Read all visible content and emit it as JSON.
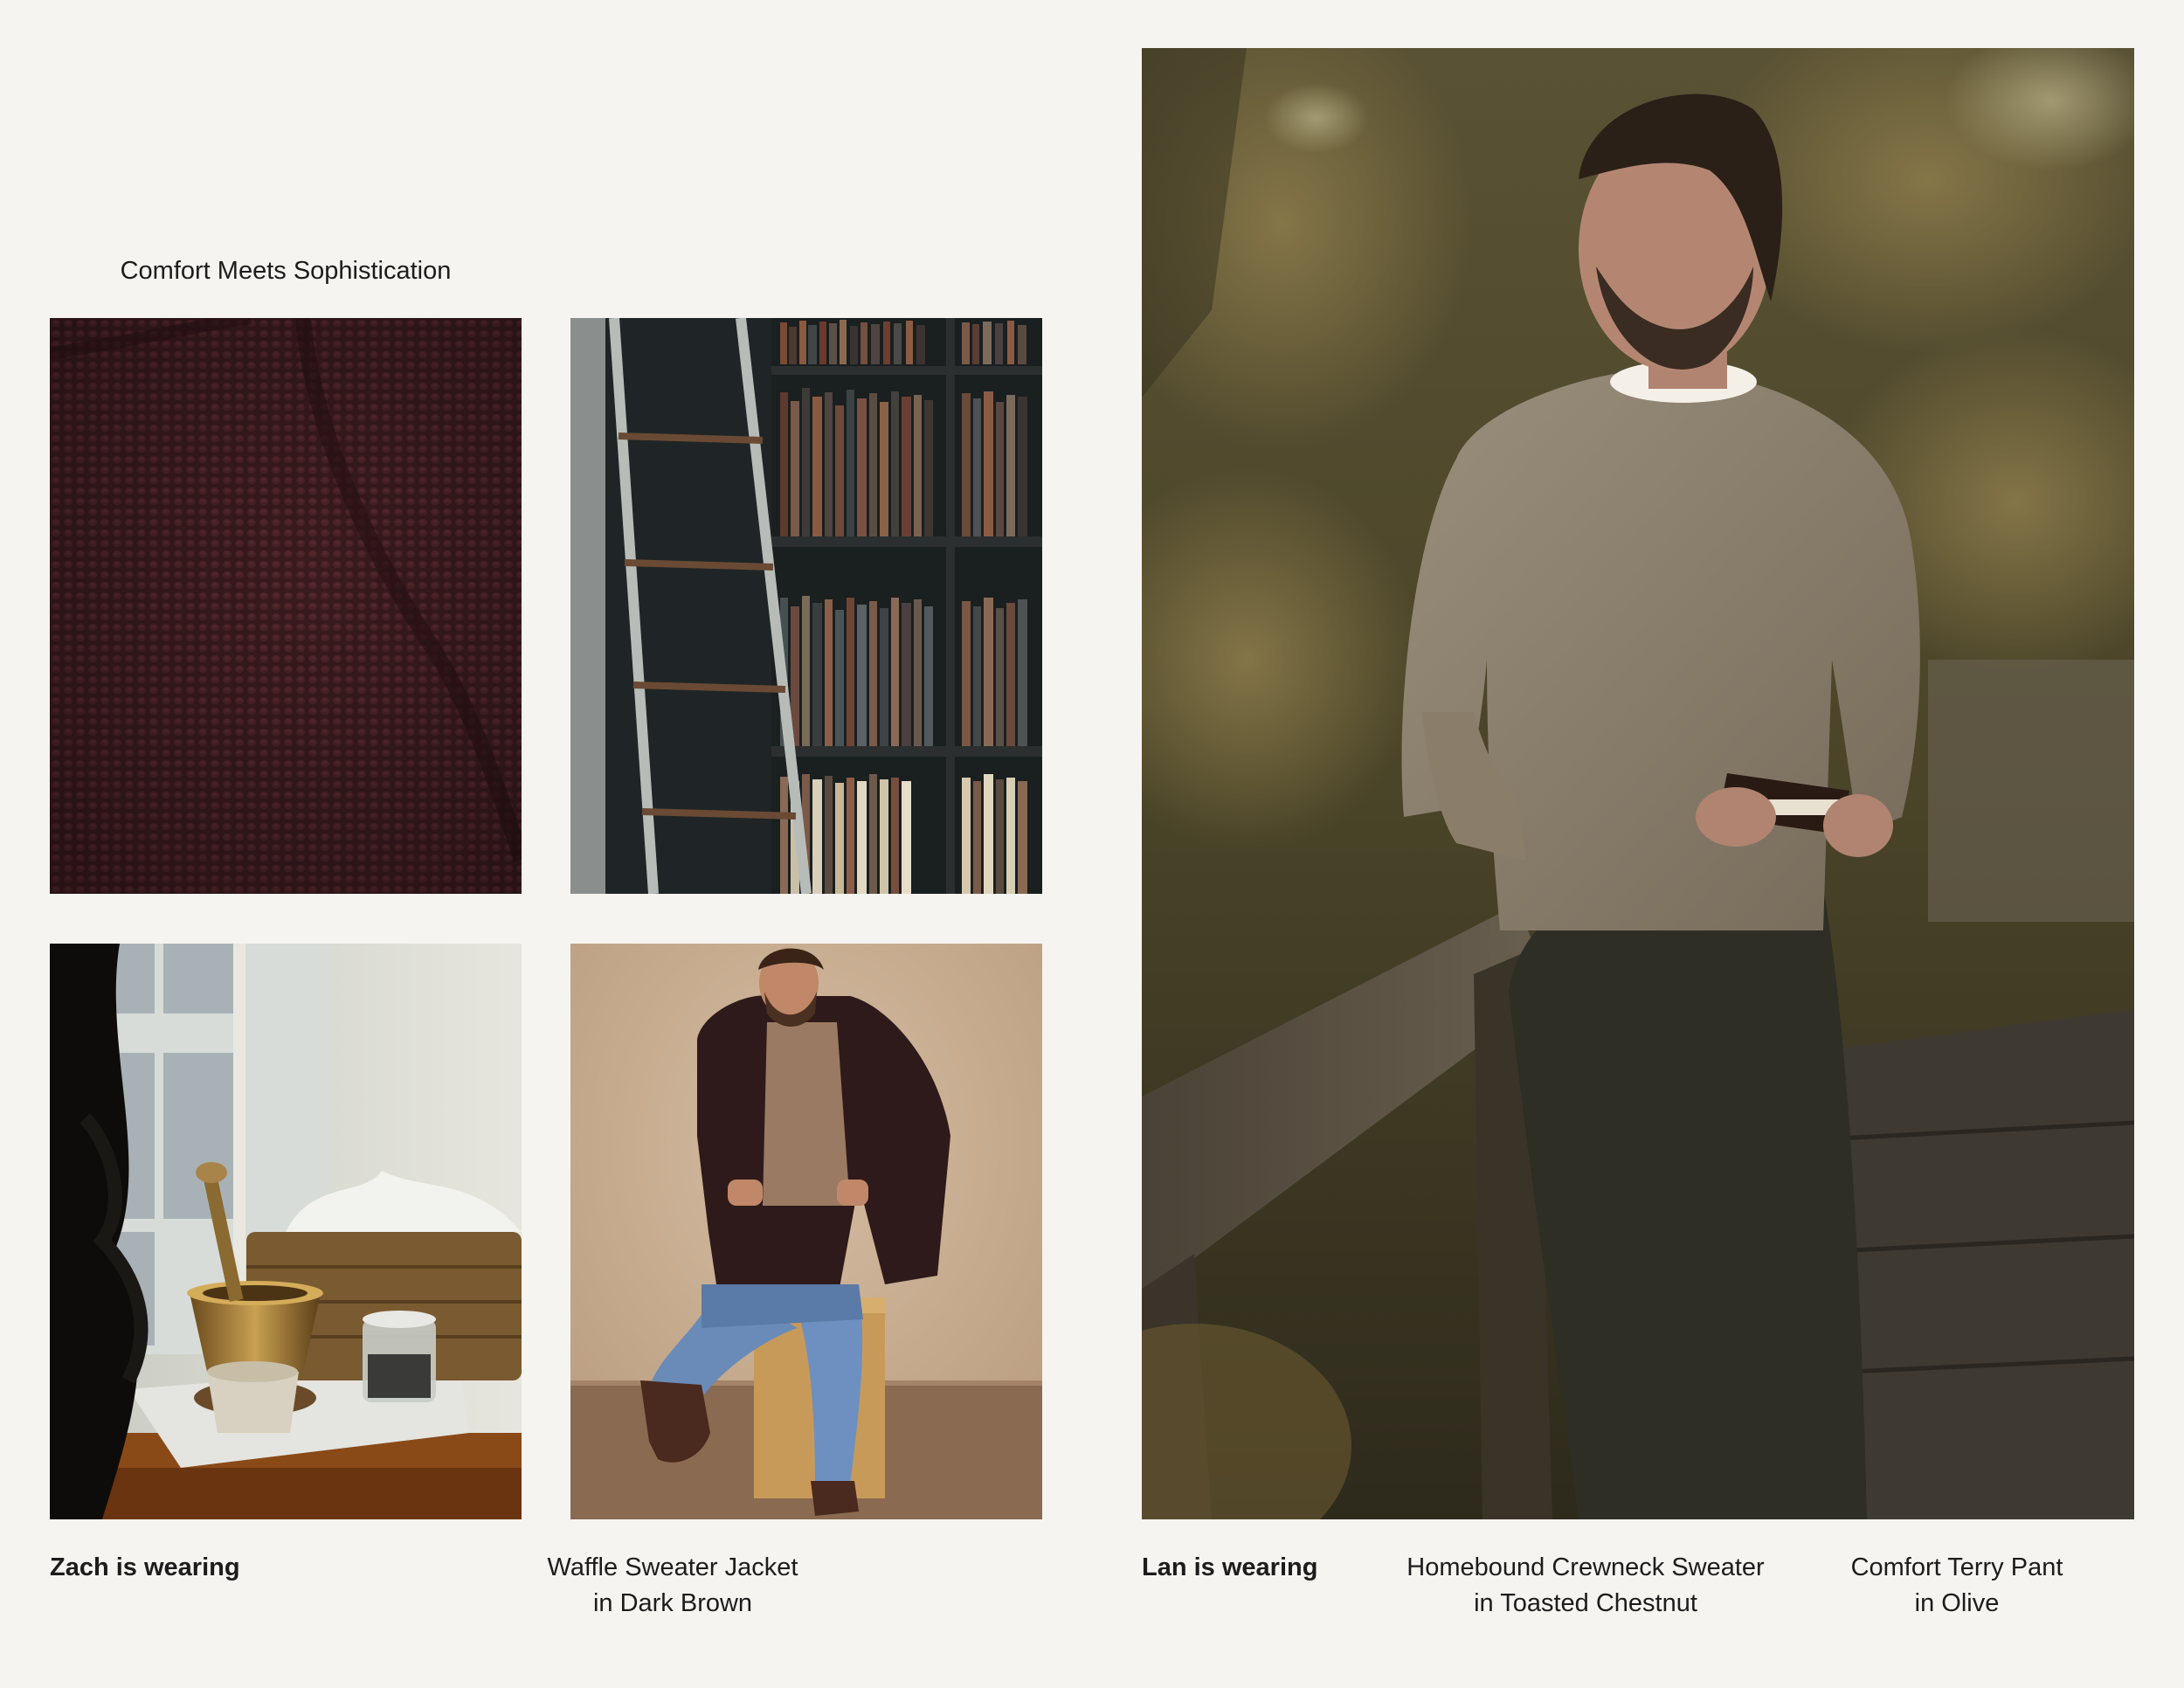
{
  "section": {
    "heading": "Comfort Meets Sophistication"
  },
  "images": {
    "knit": {
      "alt": "knit-texture-closeup"
    },
    "library": {
      "alt": "library-ladder-bookshelves"
    },
    "still_life": {
      "alt": "window-still-life"
    },
    "zach": {
      "alt": "zach-seated-portrait"
    },
    "lan": {
      "alt": "lan-outdoor-portrait"
    }
  },
  "looks": [
    {
      "label": "Zach is wearing",
      "items": [
        {
          "line1": "Waffle Sweater Jacket",
          "line2": "in Dark Brown"
        }
      ]
    },
    {
      "label": "Lan is wearing",
      "items": [
        {
          "line1": "Homebound Crewneck Sweater",
          "line2": "in Toasted Chestnut"
        },
        {
          "line1": "Comfort Terry Pant",
          "line2": "in Olive"
        }
      ]
    }
  ],
  "colors": {
    "background": "#f5f4f0",
    "text": "#1c1c1c"
  }
}
